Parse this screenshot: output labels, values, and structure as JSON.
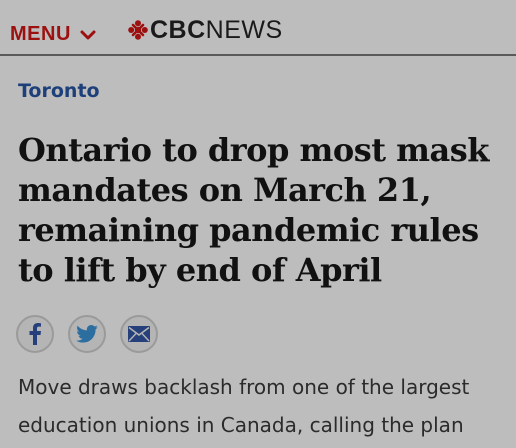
{
  "header": {
    "menu_label": "MENU",
    "logo_cbc": "CBC",
    "logo_news": "NEWS",
    "colors": {
      "menu": "#9c1010",
      "logo": "#1a1a1a"
    }
  },
  "article": {
    "section": "Toronto",
    "headline": "Ontario to drop most mask mandates on March 21, remaining pandemic rules to lift by end of April",
    "deck": "Move draws backlash from one of the largest education unions in Canada, calling the plan"
  },
  "share": {
    "icons": [
      "facebook-icon",
      "twitter-icon",
      "email-icon"
    ],
    "colors": {
      "facebook": "#25407a",
      "twitter": "#2d6ea0",
      "email": "#25407a"
    }
  }
}
